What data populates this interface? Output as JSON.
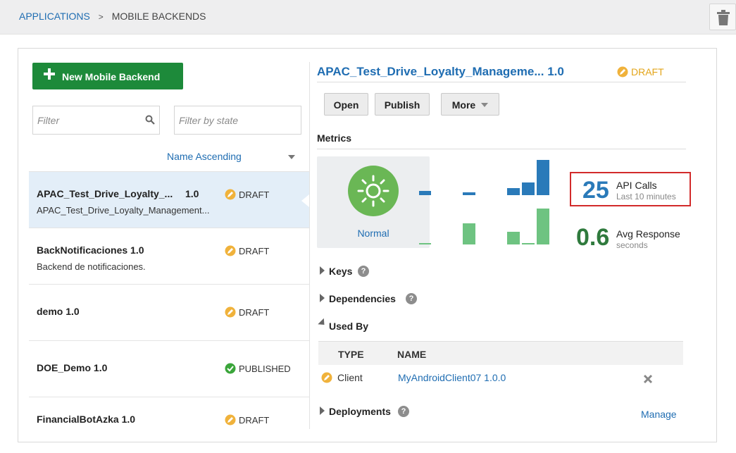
{
  "breadcrumb": {
    "applications": "APPLICATIONS",
    "separator": ">",
    "current": "MOBILE BACKENDS"
  },
  "left": {
    "new_button": "New Mobile Backend",
    "filter_placeholder": "Filter",
    "state_filter_placeholder": "Filter by state",
    "sort_label": "Name Ascending",
    "items": [
      {
        "name": "APAC_Test_Drive_Loyalty_...",
        "version": "1.0",
        "description": "APAC_Test_Drive_Loyalty_Management...",
        "state": "DRAFT"
      },
      {
        "name": "BackNotificaciones 1.0",
        "description": "Backend de notificaciones.",
        "state": "DRAFT"
      },
      {
        "name": "demo 1.0",
        "state": "DRAFT"
      },
      {
        "name": "DOE_Demo 1.0",
        "state": "PUBLISHED"
      },
      {
        "name": "FinancialBotAzka 1.0",
        "state": "DRAFT"
      }
    ]
  },
  "detail": {
    "title": "APAC_Test_Drive_Loyalty_Manageme...  1.0",
    "state": "DRAFT",
    "buttons": {
      "open": "Open",
      "publish": "Publish",
      "more": "More"
    },
    "metrics_label": "Metrics",
    "health_status": "Normal",
    "api_calls": {
      "value": "25",
      "label": "API Calls",
      "sub": "Last 10 minutes"
    },
    "avg_response": {
      "value": "0.6",
      "label": "Avg Response",
      "sub": "seconds"
    },
    "sections": {
      "keys": "Keys",
      "dependencies": "Dependencies",
      "used_by": "Used By",
      "deployments": "Deployments"
    },
    "used_by_table": {
      "headers": [
        "TYPE",
        "NAME"
      ],
      "rows": [
        {
          "type": "Client",
          "name": "MyAndroidClient07 1.0.0"
        }
      ]
    },
    "manage_link": "Manage"
  },
  "colors": {
    "accent": "#1f6db2",
    "primary_button": "#1d8a3a",
    "draft": "#e3a51a",
    "published": "#3aa53a",
    "highlight": "#d22b2b"
  },
  "icons": [
    "trash-icon",
    "search-icon",
    "sun-icon",
    "help-icon",
    "close-icon",
    "draft-icon",
    "published-icon"
  ]
}
